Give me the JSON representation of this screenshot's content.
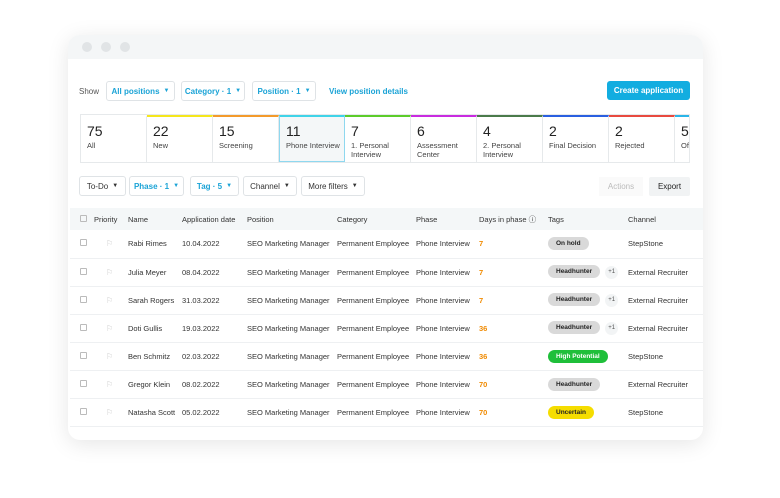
{
  "toolbar": {
    "show_label": "Show",
    "filters": [
      "All positions",
      "Category · 1",
      "Position · 1"
    ],
    "view_details": "View position details",
    "create": "Create application"
  },
  "phases": [
    {
      "count": "75",
      "label": "All",
      "color": ""
    },
    {
      "count": "22",
      "label": "New",
      "color": "#f5e61c"
    },
    {
      "count": "15",
      "label": "Screening",
      "color": "#f39a2b"
    },
    {
      "count": "11",
      "label": "Phone Interview",
      "color": "#3fd3e8"
    },
    {
      "count": "7",
      "label": "1. Personal Interview",
      "color": "#5ccc2a"
    },
    {
      "count": "6",
      "label": "Assessment Center",
      "color": "#c92be0"
    },
    {
      "count": "4",
      "label": "2. Personal Interview",
      "color": "#4a7a4a"
    },
    {
      "count": "2",
      "label": "Final Decision",
      "color": "#2a5fe0"
    },
    {
      "count": "2",
      "label": "Rejected",
      "color": "#e84a3f"
    },
    {
      "count": "5",
      "label": "Offer",
      "color": "#2ab5e8"
    }
  ],
  "filters2": {
    "todo": "To-Do",
    "phase": "Phase · 1",
    "tag": "Tag · 5",
    "channel": "Channel",
    "more": "More filters",
    "actions": "Actions",
    "export": "Export"
  },
  "table": {
    "headers": [
      "Priority",
      "Name",
      "Application date",
      "Position",
      "Category",
      "Phase",
      "Days in phase ⓘ",
      "Tags",
      "Channel"
    ],
    "rows": [
      {
        "name": "Rabi Rimes",
        "date": "10.04.2022",
        "position": "SEO Marketing Manager",
        "category": "Permanent Employee",
        "phase": "Phone Interview",
        "days": "7",
        "tag": "On hold",
        "tag_color": "#d9d9d9",
        "extra": "",
        "channel": "StepStone"
      },
      {
        "name": "Julia Meyer",
        "date": "08.04.2022",
        "position": "SEO Marketing Manager",
        "category": "Permanent Employee",
        "phase": "Phone Interview",
        "days": "7",
        "tag": "Headhunter",
        "tag_color": "#d9d9d9",
        "extra": "+1",
        "channel": "External Recruiter"
      },
      {
        "name": "Sarah Rogers",
        "date": "31.03.2022",
        "position": "SEO Marketing Manager",
        "category": "Permanent Employee",
        "phase": "Phone Interview",
        "days": "7",
        "tag": "Headhunter",
        "tag_color": "#d9d9d9",
        "extra": "+1",
        "channel": "External Recruiter"
      },
      {
        "name": "Doti Gullis",
        "date": "19.03.2022",
        "position": "SEO Marketing Manager",
        "category": "Permanent Employee",
        "phase": "Phone Interview",
        "days": "36",
        "tag": "Headhunter",
        "tag_color": "#d9d9d9",
        "extra": "+1",
        "channel": "External Recruiter"
      },
      {
        "name": "Ben Schmitz",
        "date": "02.03.2022",
        "position": "SEO Marketing Manager",
        "category": "Permanent Employee",
        "phase": "Phone Interview",
        "days": "36",
        "tag": "High Potential",
        "tag_color": "#1fbf3a",
        "extra": "",
        "channel": "StepStone"
      },
      {
        "name": "Gregor Klein",
        "date": "08.02.2022",
        "position": "SEO Marketing Manager",
        "category": "Permanent Employee",
        "phase": "Phone Interview",
        "days": "70",
        "tag": "Headhunter",
        "tag_color": "#d9d9d9",
        "extra": "",
        "channel": "External Recruiter"
      },
      {
        "name": "Natasha Scott",
        "date": "05.02.2022",
        "position": "SEO Marketing Manager",
        "category": "Permanent Employee",
        "phase": "Phone Interview",
        "days": "70",
        "tag": "Uncertain",
        "tag_color": "#f5dd00",
        "extra": "",
        "channel": "StepStone"
      }
    ]
  }
}
